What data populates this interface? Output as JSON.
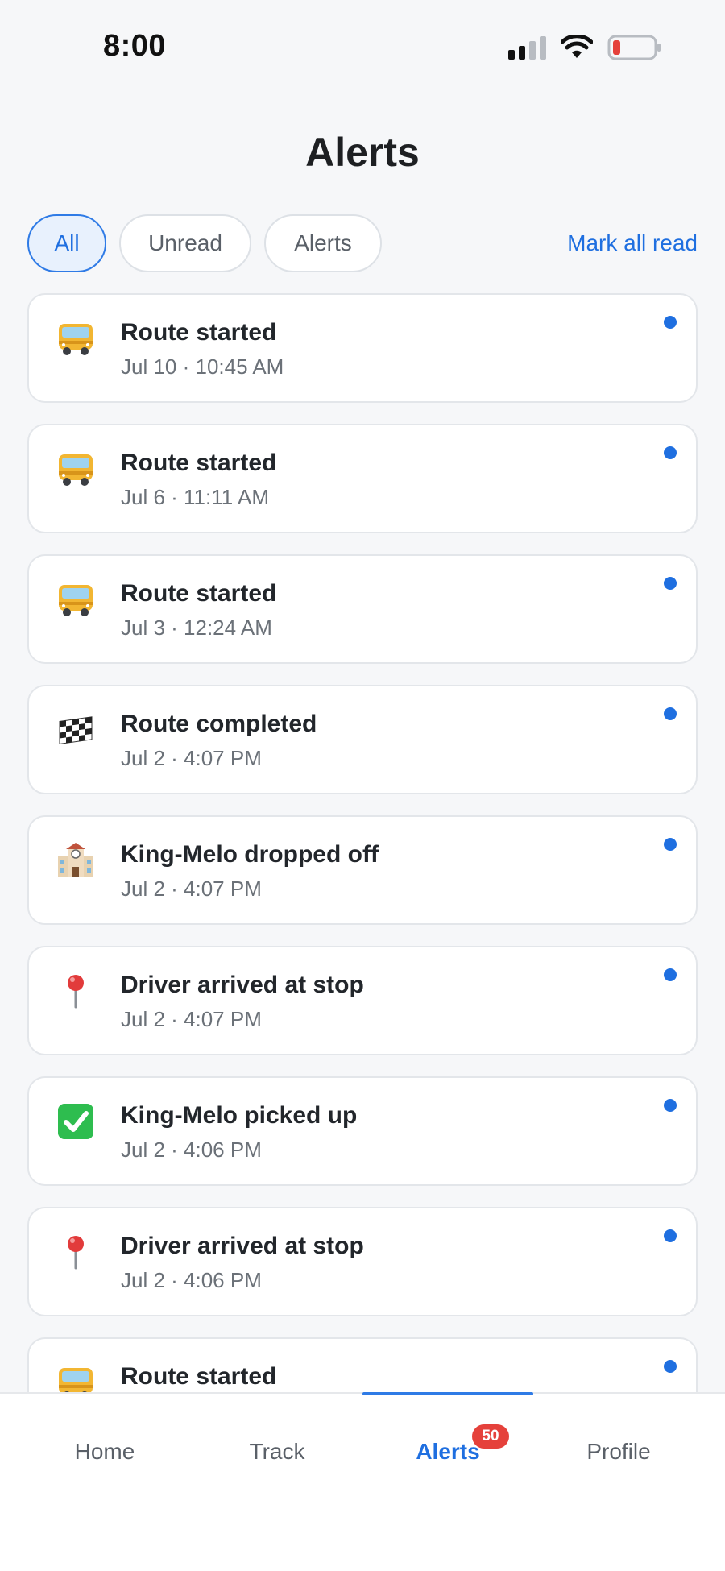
{
  "status_bar": {
    "time": "8:00",
    "signal_icon": "signal-bars-icon",
    "wifi_icon": "wifi-icon",
    "battery_icon": "battery-low-icon",
    "battery_color": "#e5413b"
  },
  "header": {
    "title": "Alerts"
  },
  "filters": {
    "items": [
      {
        "label": "All",
        "active": true
      },
      {
        "label": "Unread",
        "active": false
      },
      {
        "label": "Alerts",
        "active": false
      }
    ],
    "mark_all_label": "Mark all read"
  },
  "alerts": [
    {
      "icon": "bus-icon",
      "title": "Route started",
      "time": "Jul 10 · 10:45 AM",
      "unread": true
    },
    {
      "icon": "bus-icon",
      "title": "Route started",
      "time": "Jul 6 · 11:11 AM",
      "unread": true
    },
    {
      "icon": "bus-icon",
      "title": "Route started",
      "time": "Jul 3 · 12:24 AM",
      "unread": true
    },
    {
      "icon": "checkered-flag-icon",
      "title": "Route completed",
      "time": "Jul 2 · 4:07 PM",
      "unread": true
    },
    {
      "icon": "school-icon",
      "title": "King-Melo dropped off",
      "time": "Jul 2 · 4:07 PM",
      "unread": true
    },
    {
      "icon": "pin-icon",
      "title": "Driver arrived at stop",
      "time": "Jul 2 · 4:07 PM",
      "unread": true
    },
    {
      "icon": "check-mark-icon",
      "title": "King-Melo picked up",
      "time": "Jul 2 · 4:06 PM",
      "unread": true
    },
    {
      "icon": "pin-icon",
      "title": "Driver arrived at stop",
      "time": "Jul 2 · 4:06 PM",
      "unread": true
    },
    {
      "icon": "bus-icon",
      "title": "Route started",
      "time": "",
      "unread": true
    }
  ],
  "bottom_nav": {
    "items": [
      {
        "label": "Home",
        "active": false
      },
      {
        "label": "Track",
        "active": false
      },
      {
        "label": "Alerts",
        "active": true,
        "badge": "50"
      },
      {
        "label": "Profile",
        "active": false
      }
    ]
  },
  "colors": {
    "accent": "#1f6fe0",
    "badge": "#e5413b",
    "background": "#f6f7f9"
  }
}
